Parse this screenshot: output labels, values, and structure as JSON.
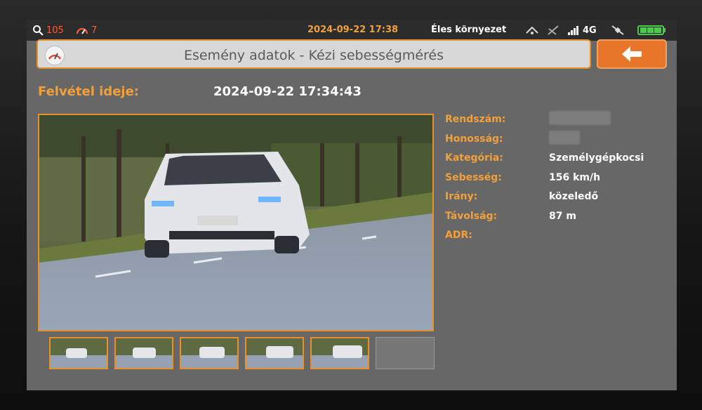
{
  "status": {
    "search_count": "105",
    "alert_count": "7",
    "datetime": "2024-09-22 17:38",
    "environment": "Éles környezet",
    "network": "4G",
    "colors": {
      "accent": "#f2a03a",
      "alert": "#ff5a3a",
      "battery": "#4fc94f"
    }
  },
  "header": {
    "title": "Esemény adatok - Kézi sebességmérés",
    "back_icon": "arrow-left-icon"
  },
  "record": {
    "label": "Felvétel ideje:",
    "value": "2024-09-22 17:34:43"
  },
  "details": [
    {
      "label": "Rendszám:",
      "value": "",
      "redacted": true
    },
    {
      "label": "Honosság:",
      "value": "",
      "redacted": true
    },
    {
      "label": "Kategória:",
      "value": "Személygépkocsi"
    },
    {
      "label": "Sebesség:",
      "value": "156 km/h"
    },
    {
      "label": "Irány:",
      "value": "közeledő"
    },
    {
      "label": "Távolság:",
      "value": "87 m"
    },
    {
      "label": "ADR:",
      "value": ""
    }
  ],
  "thumbnails": {
    "filled": 5,
    "empty": 1
  }
}
